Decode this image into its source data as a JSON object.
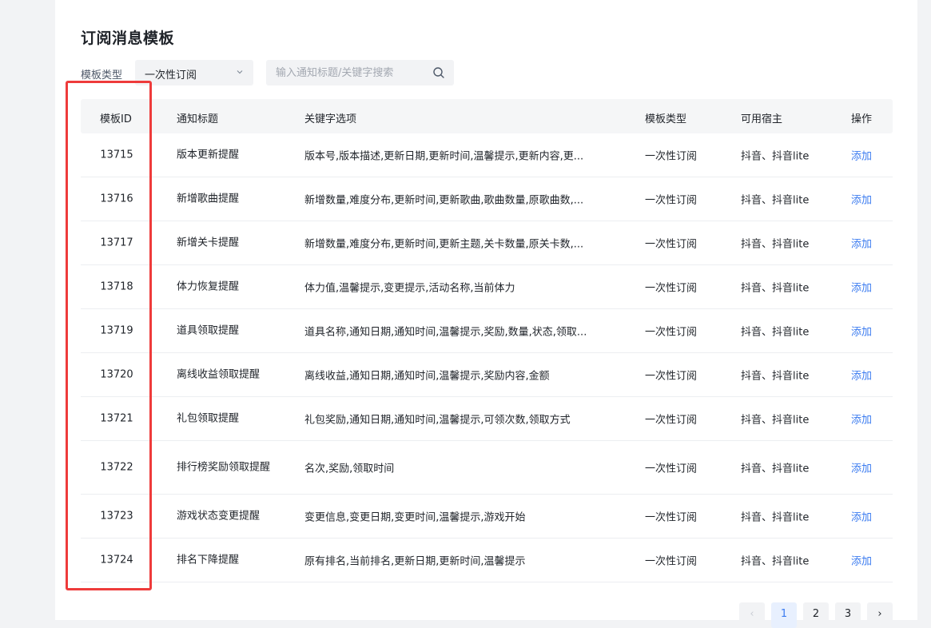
{
  "page": {
    "title": "订阅消息模板"
  },
  "filter": {
    "type_label": "模板类型",
    "type_value": "一次性订阅",
    "search_placeholder": "输入通知标题/关键字搜索"
  },
  "table": {
    "headers": {
      "id": "模板ID",
      "title": "通知标题",
      "keys": "关键字选项",
      "type": "模板类型",
      "host": "可用宿主",
      "op": "操作"
    },
    "rows": [
      {
        "id": "13715",
        "title": "版本更新提醒",
        "keys": "版本号,版本描述,更新日期,更新时间,温馨提示,更新内容,更...",
        "type": "一次性订阅",
        "host": "抖音、抖音lite",
        "op": "添加"
      },
      {
        "id": "13716",
        "title": "新增歌曲提醒",
        "keys": "新增数量,难度分布,更新时间,更新歌曲,歌曲数量,原歌曲数,...",
        "type": "一次性订阅",
        "host": "抖音、抖音lite",
        "op": "添加"
      },
      {
        "id": "13717",
        "title": "新增关卡提醒",
        "keys": "新增数量,难度分布,更新时间,更新主题,关卡数量,原关卡数,...",
        "type": "一次性订阅",
        "host": "抖音、抖音lite",
        "op": "添加"
      },
      {
        "id": "13718",
        "title": "体力恢复提醒",
        "keys": "体力值,温馨提示,变更提示,活动名称,当前体力",
        "type": "一次性订阅",
        "host": "抖音、抖音lite",
        "op": "添加"
      },
      {
        "id": "13719",
        "title": "道具领取提醒",
        "keys": "道具名称,通知日期,通知时间,温馨提示,奖励,数量,状态,领取...",
        "type": "一次性订阅",
        "host": "抖音、抖音lite",
        "op": "添加"
      },
      {
        "id": "13720",
        "title": "离线收益领取提醒",
        "keys": "离线收益,通知日期,通知时间,温馨提示,奖励内容,金额",
        "type": "一次性订阅",
        "host": "抖音、抖音lite",
        "op": "添加"
      },
      {
        "id": "13721",
        "title": "礼包领取提醒",
        "keys": "礼包奖励,通知日期,通知时间,温馨提示,可领次数,领取方式",
        "type": "一次性订阅",
        "host": "抖音、抖音lite",
        "op": "添加"
      },
      {
        "id": "13722",
        "title": "排行榜奖励领取提醒",
        "keys": "名次,奖励,领取时间",
        "type": "一次性订阅",
        "host": "抖音、抖音lite",
        "op": "添加",
        "tall": true
      },
      {
        "id": "13723",
        "title": "游戏状态变更提醒",
        "keys": "变更信息,变更日期,变更时间,温馨提示,游戏开始",
        "type": "一次性订阅",
        "host": "抖音、抖音lite",
        "op": "添加"
      },
      {
        "id": "13724",
        "title": "排名下降提醒",
        "keys": "原有排名,当前排名,更新日期,更新时间,温馨提示",
        "type": "一次性订阅",
        "host": "抖音、抖音lite",
        "op": "添加"
      }
    ]
  },
  "pagination": {
    "prev": "‹",
    "pages": [
      "1",
      "2",
      "3"
    ],
    "current": "1",
    "next": "›"
  },
  "colors": {
    "accent": "#3c7cf0",
    "highlight": "#ee3b3b"
  },
  "icons": {
    "select": "chevron-down-icon",
    "search": "search-icon"
  }
}
